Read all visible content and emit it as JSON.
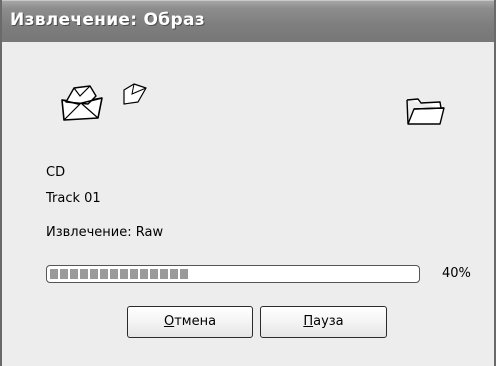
{
  "window": {
    "title": "Извлечение: Образ"
  },
  "animation": {
    "source_icon": "disc-folder-icon",
    "flying_icon": "flying-page-icon",
    "target_icon": "open-folder-icon"
  },
  "info": {
    "source": "CD",
    "track": "Track 01",
    "mode": "Извлечение: Raw"
  },
  "progress": {
    "value": 0.4,
    "percent_label": "40%"
  },
  "buttons": {
    "cancel_mnemonic": "О",
    "cancel_rest": "тмена",
    "pause_mnemonic": "П",
    "pause_rest": "ауза"
  },
  "colors": {
    "titlebar": "#7e7e7e",
    "window": "#ededed",
    "progress_block": "#9a9a9a"
  }
}
